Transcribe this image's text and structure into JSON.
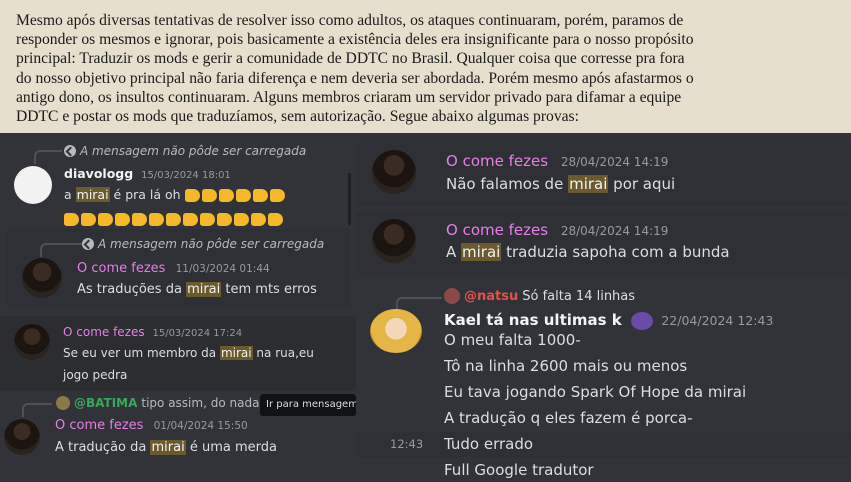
{
  "paragraph": {
    "lines": [
      "Mesmo após diversas tentativas de resolver isso como adultos, os ataques continuaram, porém, paramos de",
      "responder os mesmos e ignorar, pois basicamente a existência deles era insignificante para o nosso propósito",
      "principal: Traduzir os mods e gerir a comunidade de DDTC no Brasil. Qualquer coisa que corresse pra fora",
      "do nosso objetivo principal não faria diferença e nem deveria ser abordada. Porém mesmo após afastarmos o",
      "antigo dono, os insultos continuaram. Alguns membros criaram um servidor privado para difamar a equipe",
      "DDTC e postar os mods que traduzíamos, sem autorização. Segue abaixo algumas provas:"
    ]
  },
  "left": {
    "m1": {
      "reply": "A mensagem não pôde ser carregada",
      "author": "diavologg",
      "time": "15/03/2024 18:01",
      "pre": "a ",
      "hl": "mirai",
      "post": " é pra lá oh"
    },
    "m2": {
      "reply": "A mensagem não pôde ser carregada",
      "author": "O come fezes",
      "time": "11/03/2024 01:44",
      "pre": "As traduções da ",
      "hl": "mirai",
      "post": " tem mts erros"
    },
    "m3": {
      "author": "O come fezes",
      "time": "15/03/2024 17:24",
      "pre": "Se eu ver um membro da ",
      "hl": "mirai",
      "post": " na rua,eu",
      "line2": "jogo pedra"
    },
    "m4": {
      "reply_user": "@BATIMA",
      "reply_text": "tipo assim, do nada,",
      "author": "O come fezes",
      "time": "01/04/2024 15:50",
      "pre": "A tradução da ",
      "hl": "mirai",
      "post": " é uma merda"
    },
    "tooltip": "Ir para mensagem"
  },
  "right": {
    "m1": {
      "author": "O come fezes",
      "time": "28/04/2024 14:19",
      "pre": "Não falamos de ",
      "hl": "mirai",
      "post": " por aqui"
    },
    "m2": {
      "author": "O come fezes",
      "time": "28/04/2024 14:19",
      "pre": "A ",
      "hl": "mirai",
      "post": " traduzia sapoha com a bunda"
    },
    "m3": {
      "reply_user": "@natsu",
      "reply_text": "Só falta 14 linhas",
      "author": "Kael tá nas ultimas k",
      "time": "22/04/2024 12:43",
      "lines": [
        "O meu falta 1000-",
        "Tô na linha 2600 mais ou menos",
        "Eu tava jogando Spark Of Hope da mirai",
        "A tradução q eles fazem é porca-",
        "Tudo errado",
        "Full Google tradutor"
      ],
      "side_time": "12:43"
    }
  }
}
